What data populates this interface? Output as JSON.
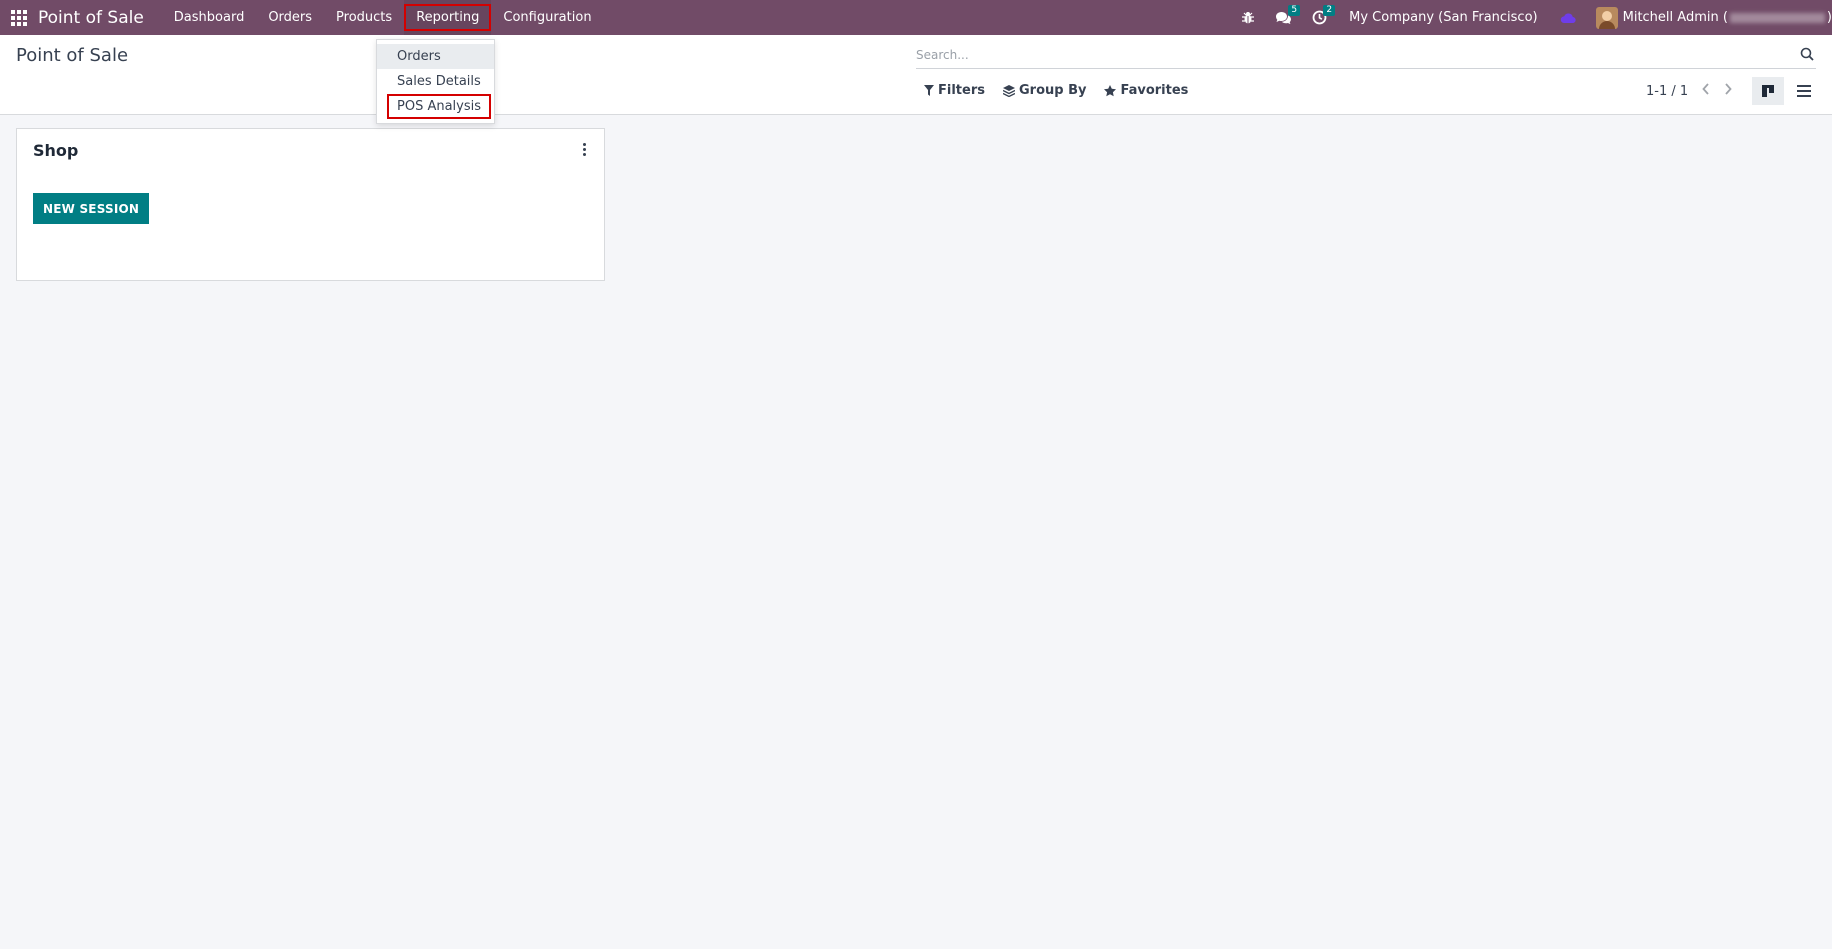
{
  "navbar": {
    "brand": "Point of Sale",
    "menu": [
      {
        "label": "Dashboard"
      },
      {
        "label": "Orders"
      },
      {
        "label": "Products"
      },
      {
        "label": "Reporting"
      },
      {
        "label": "Configuration"
      }
    ],
    "messages_count": "5",
    "activities_count": "2",
    "company": "My Company (San Francisco)",
    "user_name": "Mitchell Admin (",
    "user_name_end": ")",
    "colors": {
      "bar": "#714b67",
      "badge": "#017e84"
    },
    "icons": [
      "apps-grid-icon",
      "bug-icon",
      "chat-icon",
      "clock-icon",
      "cloud-icon"
    ]
  },
  "reporting_dropdown": {
    "items": [
      {
        "label": "Orders"
      },
      {
        "label": "Sales Details"
      },
      {
        "label": "POS Analysis"
      }
    ]
  },
  "control_panel": {
    "title": "Point of Sale",
    "search_placeholder": "Search...",
    "filters_label": "Filters",
    "group_by_label": "Group By",
    "favorites_label": "Favorites",
    "pager": "1-1 / 1"
  },
  "card": {
    "title": "Shop",
    "button_label": "NEW SESSION",
    "button_color": "#017e84"
  }
}
